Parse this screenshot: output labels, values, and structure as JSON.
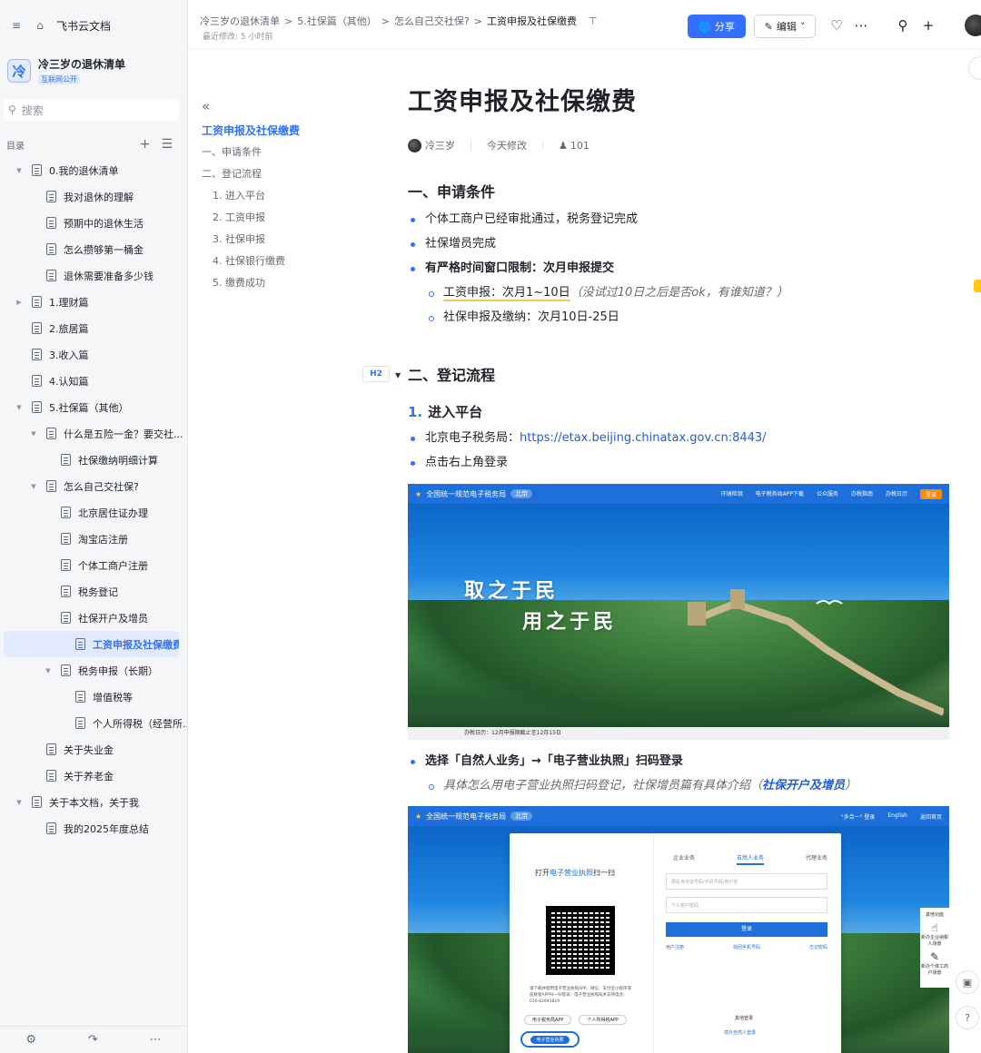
{
  "sidebar": {
    "brand": "飞书云文档",
    "space_name": "冷三岁の退休清单",
    "space_logo": "冷",
    "space_badge": "互联网公开",
    "search_placeholder": "搜索",
    "toc_label": "目录",
    "tree": [
      {
        "label": "0.我的退休清单",
        "level": 0,
        "caret": "down"
      },
      {
        "label": "我对退休的理解",
        "level": 1,
        "caret": ""
      },
      {
        "label": "预期中的退休生活",
        "level": 1,
        "caret": ""
      },
      {
        "label": "怎么攒够第一桶金",
        "level": 1,
        "caret": ""
      },
      {
        "label": "退休需要准备多少钱",
        "level": 1,
        "caret": ""
      },
      {
        "label": "1.理财篇",
        "level": 0,
        "caret": "right"
      },
      {
        "label": "2.旅居篇",
        "level": 0,
        "caret": ""
      },
      {
        "label": "3.收入篇",
        "level": 0,
        "caret": ""
      },
      {
        "label": "4.认知篇",
        "level": 0,
        "caret": ""
      },
      {
        "label": "5.社保篇（其他）",
        "level": 0,
        "caret": "down"
      },
      {
        "label": "什么是五险一金？要交社...",
        "level": 1,
        "caret": "down"
      },
      {
        "label": "社保缴纳明细计算",
        "level": 2,
        "caret": ""
      },
      {
        "label": "怎么自己交社保?",
        "level": 1,
        "caret": "down"
      },
      {
        "label": "北京居住证办理",
        "level": 2,
        "caret": ""
      },
      {
        "label": "淘宝店注册",
        "level": 2,
        "caret": ""
      },
      {
        "label": "个体工商户注册",
        "level": 2,
        "caret": ""
      },
      {
        "label": "税务登记",
        "level": 2,
        "caret": ""
      },
      {
        "label": "社保开户及增员",
        "level": 2,
        "caret": ""
      },
      {
        "label": "工资申报及社保缴费",
        "level": 2,
        "caret": "",
        "active": true
      },
      {
        "label": "税务申报（长期）",
        "level": 2,
        "caret": "down"
      },
      {
        "label": "增值税等",
        "level": 3,
        "caret": ""
      },
      {
        "label": "个人所得税（经营所...",
        "level": 3,
        "caret": ""
      },
      {
        "label": "关于失业金",
        "level": 1,
        "caret": ""
      },
      {
        "label": "关于养老金",
        "level": 1,
        "caret": ""
      },
      {
        "label": "关于本文档，关于我",
        "level": 0,
        "caret": "down"
      },
      {
        "label": "我的2025年度总结",
        "level": 1,
        "caret": ""
      }
    ]
  },
  "header": {
    "breadcrumb": [
      "冷三岁の退休清单",
      "5.社保篇（其他）",
      "怎么自己交社保?",
      "工资申报及社保缴费"
    ],
    "last_modified": "最近修改: 5 小时前",
    "share_label": "分享",
    "edit_label": "编辑"
  },
  "outline": {
    "items": [
      {
        "label": "工资申报及社保缴费",
        "level": 0,
        "active": true
      },
      {
        "label": "一、申请条件",
        "level": 1
      },
      {
        "label": "二、登记流程",
        "level": 1
      },
      {
        "label": "1. 进入平台",
        "level": 2
      },
      {
        "label": "2. 工资申报",
        "level": 2
      },
      {
        "label": "3. 社保申报",
        "level": 2
      },
      {
        "label": "4. 社保银行缴费",
        "level": 2
      },
      {
        "label": "5. 缴费成功",
        "level": 2
      }
    ]
  },
  "doc": {
    "title": "工资申报及社保缴费",
    "author": "冷三岁",
    "modified": "今天修改",
    "views": "101",
    "section1": {
      "heading": "一、申请条件",
      "b1": "个体工商户已经审批通过，税务登记完成",
      "b2": "社保增员完成",
      "b3": "有严格时间窗口限制：次月申报提交",
      "s1_main": "工资申报：次月1~10日",
      "s1_note": "（没试过10日之后是否ok，有谁知道？）",
      "s2": "社保申报及缴纳：次月10日-25日"
    },
    "section2": {
      "heading": "二、登记流程",
      "hmark": "H2",
      "sub1_num": "1.",
      "sub1": "进入平台",
      "b1_prefix": "北京电子税务局：",
      "b1_link": "https://etax.beijing.chinatax.gov.cn:8443/",
      "b2": "点击右上角登录",
      "b3": "选择「自然人业务」→「电子营业执照」扫码登录",
      "s1_note": "具体怎么用电子营业执照扫码登记，社保增员篇有具体介绍（",
      "s1_link": "社保开户及增员",
      "s1_close": "）"
    },
    "image1": {
      "site_title": "全国统一规范电子税务局",
      "region": "北京",
      "nav": [
        "环境检测",
        "电子税务局APP下载",
        "公众服务",
        "办税指南",
        "办税日历"
      ],
      "login": "登录",
      "slogan1": "取之于民",
      "slogan2": "用之于民",
      "caption": "办税日历：12月申报期截止至12月15日"
    },
    "image2": {
      "site_title": "全国统一规范电子税务局",
      "region": "北京",
      "nav": [
        "\"多合一\" 登录",
        "English",
        "返回首页"
      ],
      "scan_prefix": "打开",
      "scan_link": "电子营业执照",
      "scan_suffix": "扫一扫",
      "tabs": [
        "企业业务",
        "自然人业务",
        "代理业务"
      ],
      "field1": "居民身份证号码/手机号码/用户名",
      "field2": "个人用户密码",
      "login_btn": "登录",
      "links": [
        "用户注册",
        "找回手机号码",
        "忘记密码"
      ],
      "other_login": "其他登录",
      "outside_login": "境外自然人登录",
      "qr_text": "请下载并使用电子营业执照APP、微信、支付宝小程序或皮肤管APP扫一扫登录；电子营业执照技术支持电话：010-82691819",
      "qr_btns": [
        "电子税务局APP",
        "个人所得税APP"
      ],
      "active_btn": "电子营业执照",
      "side_widget": [
        "其他功能",
        "新办企业纳税人场景",
        "新办个体工商户场景"
      ]
    }
  }
}
